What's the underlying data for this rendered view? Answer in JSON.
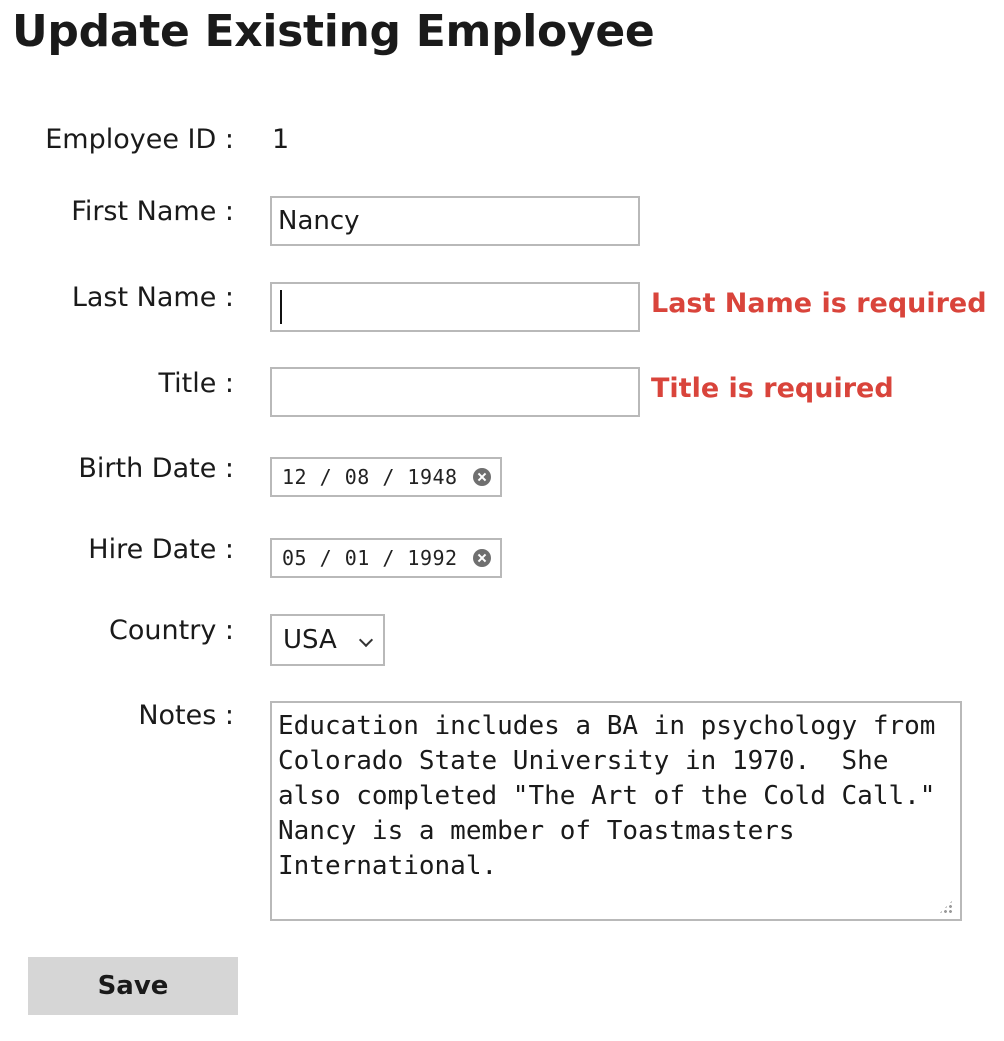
{
  "page": {
    "title": "Update Existing Employee"
  },
  "form": {
    "employee_id": {
      "label": "Employee ID :",
      "value": "1"
    },
    "first_name": {
      "label": "First Name :",
      "value": "Nancy"
    },
    "last_name": {
      "label": "Last Name :",
      "value": "",
      "error": "Last Name is required"
    },
    "title": {
      "label": "Title :",
      "value": "",
      "error": "Title is required"
    },
    "birth_date": {
      "label": "Birth Date :",
      "value": "12 / 08 / 1948"
    },
    "hire_date": {
      "label": "Hire Date :",
      "value": "05 / 01 / 1992"
    },
    "country": {
      "label": "Country :",
      "selected": "USA"
    },
    "notes": {
      "label": "Notes :",
      "value": "Education includes a BA in psychology from Colorado State University in 1970.  She also completed \"The Art of the Cold Call.\" Nancy is a member of Toastmasters International."
    },
    "save_label": "Save"
  },
  "colors": {
    "error": "#d9443b",
    "input_border": "#b9b9b9",
    "button_bg": "#d6d6d6"
  },
  "icons": {
    "date_clear": "clear-circle-x-icon",
    "select_arrow": "chevron-down-icon",
    "textarea_resize": "resize-grip-icon"
  }
}
